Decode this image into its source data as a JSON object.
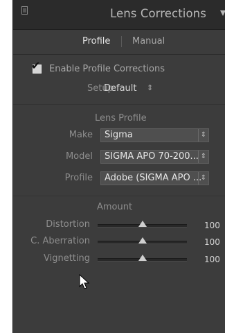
{
  "panel": {
    "title": "Lens Corrections"
  },
  "tabs": [
    {
      "label": "Profile",
      "active": true
    },
    {
      "label": "Manual",
      "active": false
    }
  ],
  "enable_profile": {
    "label": "Enable Profile Corrections",
    "checked": true
  },
  "setup": {
    "label": "Setup",
    "value": "Default",
    "arrows": "⇕"
  },
  "lens_profile": {
    "title": "Lens Profile",
    "rows": [
      {
        "label": "Make",
        "value": "Sigma",
        "caret": "⇕"
      },
      {
        "label": "Model",
        "value": "SIGMA APO 70-200...",
        "caret": "⇕"
      },
      {
        "label": "Profile",
        "value": "Adobe (SIGMA APO ...",
        "caret": "⇕"
      }
    ]
  },
  "amount": {
    "title": "Amount",
    "sliders": [
      {
        "label": "Distortion",
        "value": "100",
        "level": 0.5
      },
      {
        "label": "C. Aberration",
        "value": "100",
        "level": 0.5
      },
      {
        "label": "Vignetting",
        "value": "100",
        "level": 0.5
      }
    ]
  },
  "colors": {
    "panel_bg": "#3c3c3c",
    "header_bg": "#2b2b2b",
    "text_dim": "#8d8d8d",
    "text_bright": "#e6e6e6"
  }
}
